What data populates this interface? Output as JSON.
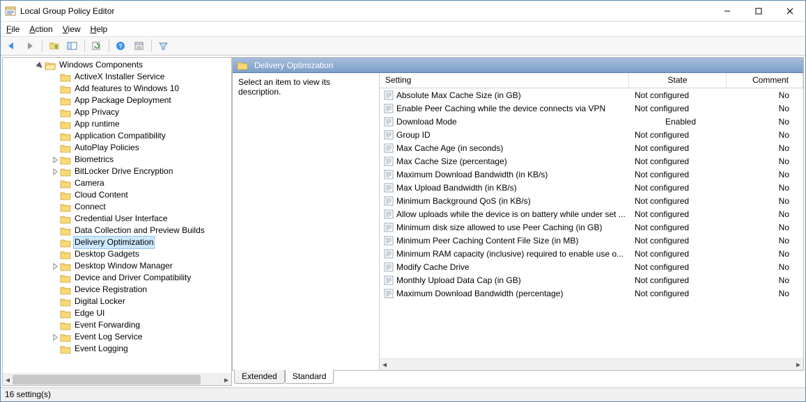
{
  "window": {
    "title": "Local Group Policy Editor"
  },
  "menu": {
    "file": "File",
    "action": "Action",
    "view": "View",
    "help": "Help"
  },
  "tree": {
    "root": "Windows Components",
    "items": [
      {
        "label": "ActiveX Installer Service",
        "expander": null
      },
      {
        "label": "Add features to Windows 10",
        "expander": null
      },
      {
        "label": "App Package Deployment",
        "expander": null
      },
      {
        "label": "App Privacy",
        "expander": null
      },
      {
        "label": "App runtime",
        "expander": null
      },
      {
        "label": "Application Compatibility",
        "expander": null
      },
      {
        "label": "AutoPlay Policies",
        "expander": null
      },
      {
        "label": "Biometrics",
        "expander": "closed"
      },
      {
        "label": "BitLocker Drive Encryption",
        "expander": "closed"
      },
      {
        "label": "Camera",
        "expander": null
      },
      {
        "label": "Cloud Content",
        "expander": null
      },
      {
        "label": "Connect",
        "expander": null
      },
      {
        "label": "Credential User Interface",
        "expander": null
      },
      {
        "label": "Data Collection and Preview Builds",
        "expander": null
      },
      {
        "label": "Delivery Optimization",
        "expander": null,
        "selected": true
      },
      {
        "label": "Desktop Gadgets",
        "expander": null
      },
      {
        "label": "Desktop Window Manager",
        "expander": "closed"
      },
      {
        "label": "Device and Driver Compatibility",
        "expander": null
      },
      {
        "label": "Device Registration",
        "expander": null
      },
      {
        "label": "Digital Locker",
        "expander": null
      },
      {
        "label": "Edge UI",
        "expander": null
      },
      {
        "label": "Event Forwarding",
        "expander": null
      },
      {
        "label": "Event Log Service",
        "expander": "closed"
      },
      {
        "label": "Event Logging",
        "expander": null
      }
    ]
  },
  "right": {
    "header": "Delivery Optimization",
    "description_prompt": "Select an item to view its description.",
    "columns": {
      "setting": "Setting",
      "state": "State",
      "comment": "Comment"
    },
    "rows": [
      {
        "setting": "Absolute Max Cache Size (in GB)",
        "state": "Not configured",
        "comment": "No"
      },
      {
        "setting": "Enable Peer Caching while the device connects via VPN",
        "state": "Not configured",
        "comment": "No"
      },
      {
        "setting": "Download Mode",
        "state": "Enabled",
        "comment": "No"
      },
      {
        "setting": "Group ID",
        "state": "Not configured",
        "comment": "No"
      },
      {
        "setting": "Max Cache Age (in seconds)",
        "state": "Not configured",
        "comment": "No"
      },
      {
        "setting": "Max Cache Size (percentage)",
        "state": "Not configured",
        "comment": "No"
      },
      {
        "setting": "Maximum Download Bandwidth (in KB/s)",
        "state": "Not configured",
        "comment": "No"
      },
      {
        "setting": "Max Upload Bandwidth (in KB/s)",
        "state": "Not configured",
        "comment": "No"
      },
      {
        "setting": "Minimum Background QoS (in KB/s)",
        "state": "Not configured",
        "comment": "No"
      },
      {
        "setting": "Allow uploads while the device is on battery while under set ...",
        "state": "Not configured",
        "comment": "No"
      },
      {
        "setting": "Minimum disk size allowed to use Peer Caching (in GB)",
        "state": "Not configured",
        "comment": "No"
      },
      {
        "setting": "Minimum Peer Caching Content File Size (in MB)",
        "state": "Not configured",
        "comment": "No"
      },
      {
        "setting": "Minimum RAM capacity (inclusive) required to enable use o...",
        "state": "Not configured",
        "comment": "No"
      },
      {
        "setting": "Modify Cache Drive",
        "state": "Not configured",
        "comment": "No"
      },
      {
        "setting": "Monthly Upload Data Cap (in GB)",
        "state": "Not configured",
        "comment": "No"
      },
      {
        "setting": "Maximum Download Bandwidth (percentage)",
        "state": "Not configured",
        "comment": "No"
      }
    ]
  },
  "tabs": {
    "extended": "Extended",
    "standard": "Standard"
  },
  "status": "16 setting(s)"
}
